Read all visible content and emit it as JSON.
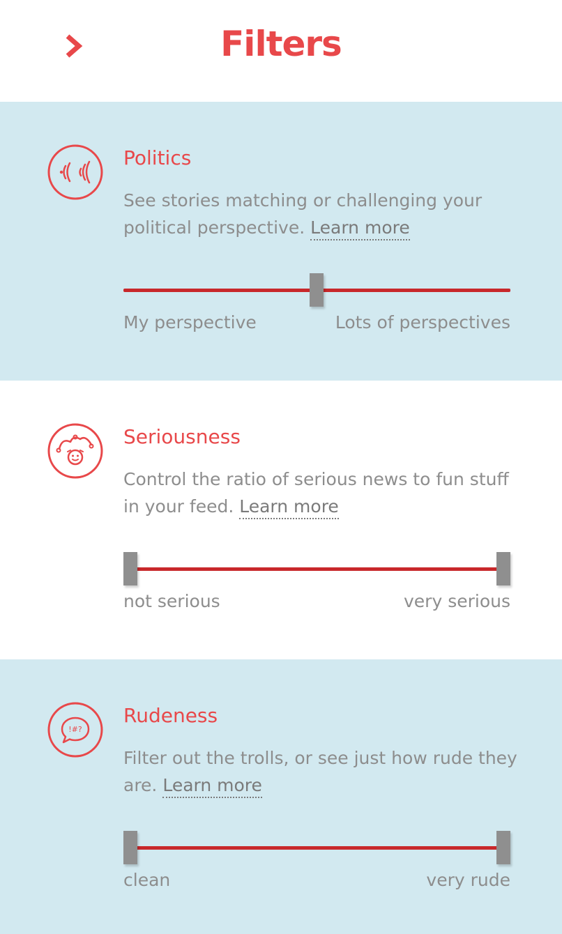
{
  "header": {
    "title": "Filters",
    "back_icon": "chevron-right-icon"
  },
  "colors": {
    "accent": "#e8484a",
    "track": "#c8282b",
    "thumb": "#8f8f8f",
    "section_blue": "#d2e9f0",
    "text_muted": "#8d8d8d"
  },
  "filters": [
    {
      "title": "Politics",
      "icon": "broadcast-icon",
      "description": "See stories matching or challenging your political perspective.",
      "learn_more": "Learn more",
      "min_label": "My perspective",
      "max_label": "Lots of perspectives",
      "value": 0.5
    },
    {
      "title": "Seriousness",
      "icon": "jester-icon",
      "description": "Control the ratio of serious news to fun stuff in your feed.",
      "learn_more": "Learn more",
      "min_label": "not serious",
      "max_label": "very serious",
      "range": [
        0,
        1
      ]
    },
    {
      "title": "Rudeness",
      "icon": "speech-bubble-swear-icon",
      "description": "Filter out the trolls, or see just how rude they are.",
      "learn_more": "Learn more",
      "min_label": "clean",
      "max_label": "very rude",
      "range": [
        0,
        1
      ]
    }
  ]
}
